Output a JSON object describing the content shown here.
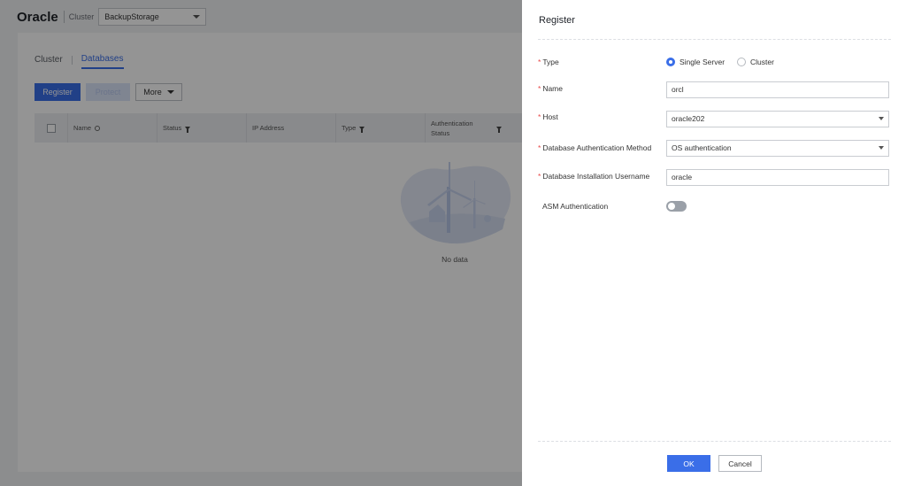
{
  "header": {
    "app_title": "Oracle",
    "cluster_label": "Cluster",
    "cluster_value": "BackupStorage"
  },
  "tabs": [
    {
      "label": "Cluster",
      "active": false
    },
    {
      "label": "Databases",
      "active": true
    }
  ],
  "toolbar": {
    "register_label": "Register",
    "protect_label": "Protect",
    "more_label": "More"
  },
  "table": {
    "columns": [
      "Name",
      "Status",
      "IP Address",
      "Type",
      "Authentication Status"
    ],
    "column_icons": [
      "search-icon",
      "filter-icon",
      "",
      "filter-icon",
      "filter-icon"
    ],
    "empty_text": "No data",
    "rows": []
  },
  "drawer": {
    "title": "Register",
    "type_label": "Type",
    "type_options": [
      "Single Server",
      "Cluster"
    ],
    "type_selected": "Single Server",
    "name_label": "Name",
    "name_value": "orcl",
    "host_label": "Host",
    "host_value": "oracle202",
    "auth_method_label": "Database Authentication Method",
    "auth_method_value": "OS authentication",
    "install_user_label": "Database Installation Username",
    "install_user_value": "oracle",
    "asm_label": "ASM Authentication",
    "asm_enabled": false,
    "ok_label": "OK",
    "cancel_label": "Cancel"
  },
  "colors": {
    "accent": "#3a6ee8",
    "required": "#e84a4a",
    "overlay": "rgba(0,0,0,0.42)"
  }
}
